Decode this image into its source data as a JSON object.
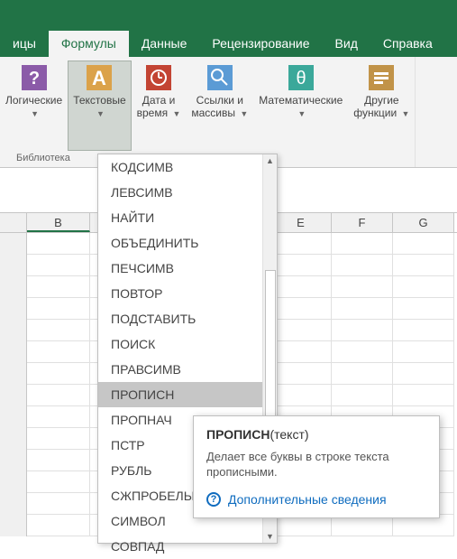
{
  "tabs": [
    "ицы",
    "Формулы",
    "Данные",
    "Рецензирование",
    "Вид",
    "Справка"
  ],
  "activeTab": 1,
  "ribbon": {
    "logic": {
      "label": "Логические"
    },
    "text": {
      "label": "Текстовые"
    },
    "date": {
      "label1": "Дата и",
      "label2": "время"
    },
    "lookup": {
      "label1": "Ссылки и",
      "label2": "массивы"
    },
    "math": {
      "label": "Математические"
    },
    "more": {
      "label1": "Другие",
      "label2": "функции"
    },
    "groupLabel": "Библиотека"
  },
  "dropdown": {
    "items": [
      "КОДСИМВ",
      "ЛЕВСИМВ",
      "НАЙТИ",
      "ОБЪЕДИНИТЬ",
      "ПЕЧСИМВ",
      "ПОВТОР",
      "ПОДСТАВИТЬ",
      "ПОИСК",
      "ПРАВСИМВ",
      "ПРОПИСН",
      "ПРОПНАЧ",
      "ПСТР",
      "РУБЛЬ",
      "СЖПРОБЕЛЫ",
      "СИМВОЛ",
      "СОВПАД"
    ],
    "selectedIndex": 9
  },
  "columns": [
    "B",
    "E",
    "F",
    "G"
  ],
  "tooltip": {
    "fn": "ПРОПИСН",
    "sig": "(текст)",
    "desc": "Делает все буквы в строке текста прописными.",
    "link": "Дополнительные сведения"
  }
}
